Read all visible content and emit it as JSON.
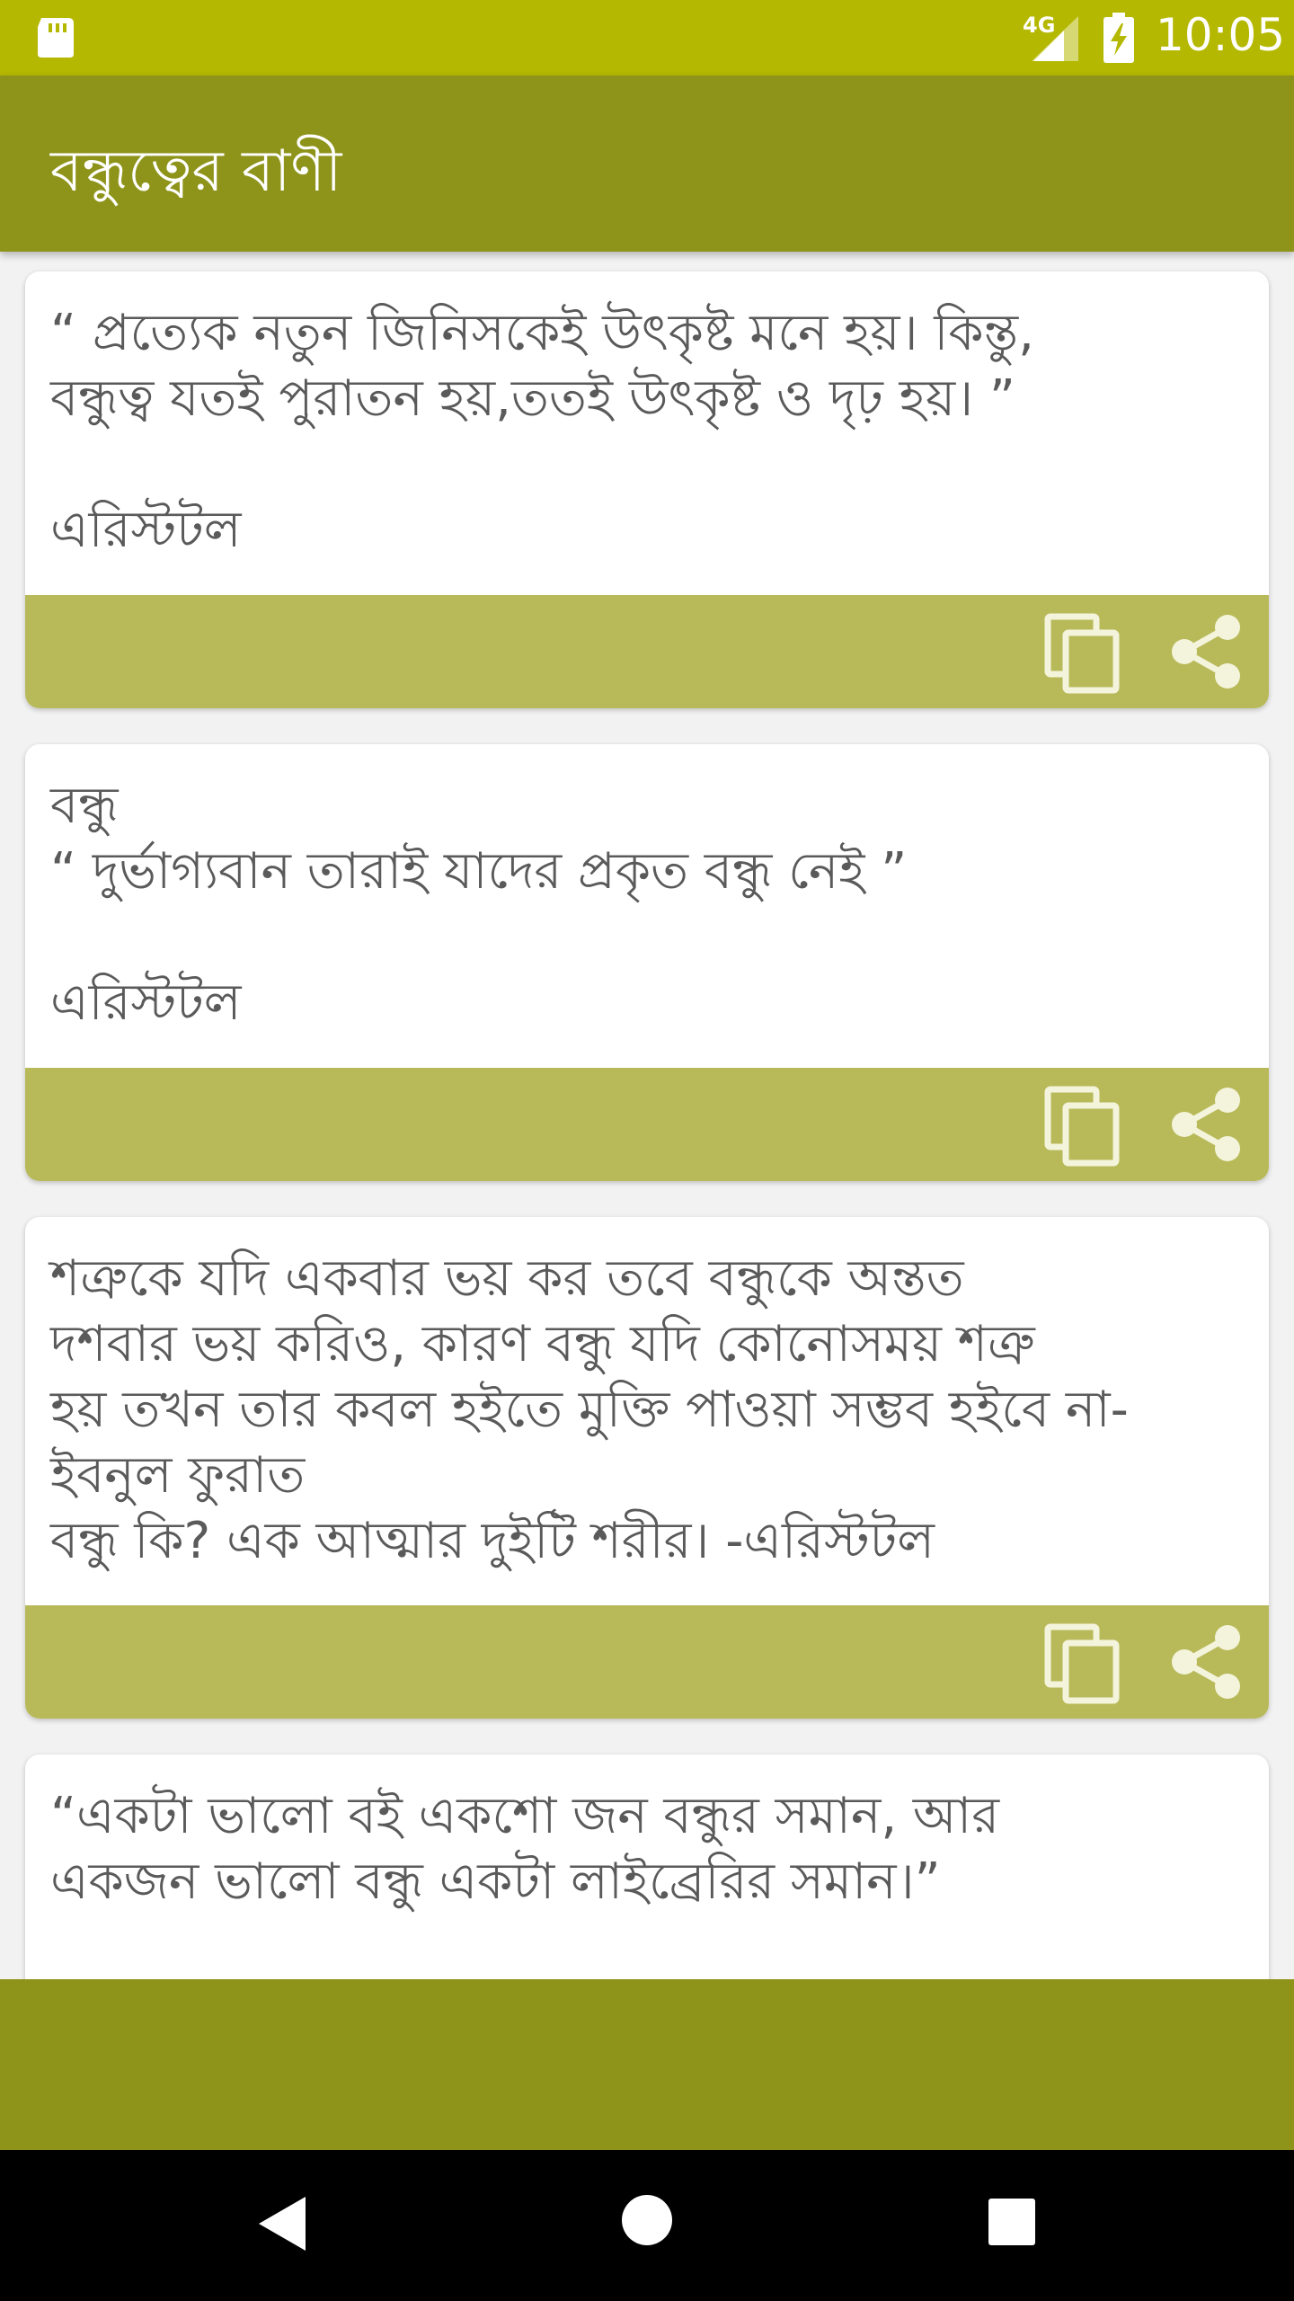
{
  "status_bar": {
    "network": "4G",
    "time": "10:05",
    "icons": [
      "sd-card-icon",
      "signal-icon",
      "battery-charging-icon"
    ]
  },
  "app_bar": {
    "title": "বন্ধুত্বের বাণী"
  },
  "quotes": [
    {
      "text": "“ প্রত্যেক নতুন জিনিসকেই উৎকৃষ্ট মনে হয়। কিন্তু,\nবন্ধুত্ব যতই পুরাতন হয়,ততই উৎকৃষ্ট ও দৃঢ় হয়। ”\n\nএরিস্টটল"
    },
    {
      "text": "বন্ধু\n“ দুর্ভাগ্যবান তারাই যাদের প্রকৃত বন্ধু নেই ”\n\nএরিস্টটল"
    },
    {
      "text": "শত্রুকে যদি একবার ভয় কর তবে বন্ধুকে অন্তত\nদশবার ভয় করিও, কারণ বন্ধু যদি কোনোসময় শত্রু\nহয় তখন তার কবল হইতে মুক্তি পাওয়া সম্ভব হইবে না-\nইবনুল ফুরাত\nবন্ধু কি? এক আত্মার দুইটি শরীর।  -এরিস্টটল"
    },
    {
      "text": "“একটা ভালো বই একশো জন বন্ধুর সমান, আর\nএকজন ভালো বন্ধু একটা লাইব্রেরির সমান।”"
    }
  ],
  "card_actions": {
    "copy_icon": "copy-icon",
    "share_icon": "share-icon"
  },
  "nav_bar": {
    "icons": [
      "back-icon",
      "home-icon",
      "recents-icon"
    ]
  },
  "colors": {
    "status_bar": "#b5b800",
    "app_bar": "#8e931a",
    "card_actions": "#b8ba5a",
    "quote_text": "#5a5a5a"
  }
}
